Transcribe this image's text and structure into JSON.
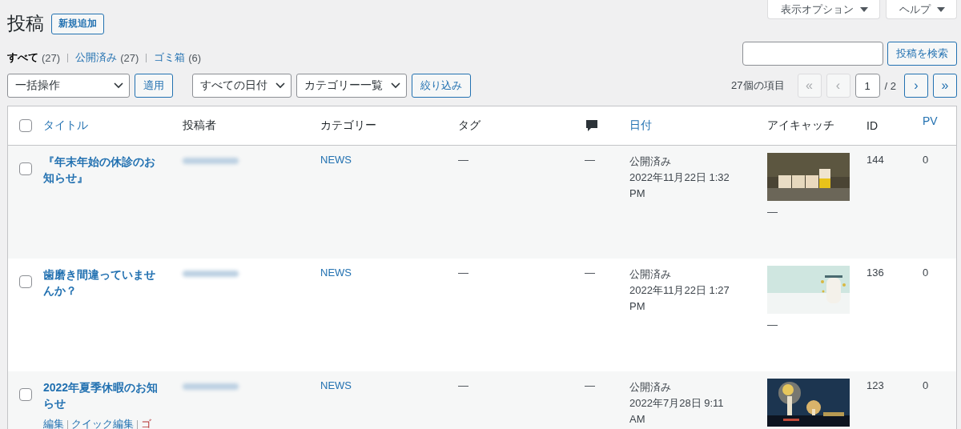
{
  "screen_tabs": [
    {
      "label": "表示オプション",
      "expanded": false
    },
    {
      "label": "ヘルプ",
      "expanded": false
    }
  ],
  "page_title": "投稿",
  "add_new_button": "新規追加",
  "views": [
    {
      "label": "すべて",
      "count": "(27)",
      "selected": true
    },
    {
      "label": "公開済み",
      "count": "(27)",
      "selected": false
    },
    {
      "label": "ゴミ箱",
      "count": "(6)",
      "selected": false
    }
  ],
  "search": {
    "button": "投稿を検索"
  },
  "bulk_actions": {
    "value": "一括操作",
    "button": "適用"
  },
  "filters": [
    {
      "value": "すべての日付"
    },
    {
      "value": "カテゴリー一覧"
    }
  ],
  "filter_button": "絞り込み",
  "pagination": {
    "items": "27個の項目",
    "current": "1",
    "total": "/ 2",
    "before": [
      {
        "label": "«",
        "disabled": true
      },
      {
        "label": "‹",
        "disabled": true
      }
    ],
    "after": [
      {
        "label": "›",
        "disabled": false
      },
      {
        "label": "»",
        "disabled": false
      }
    ]
  },
  "table": {
    "header_checked": false,
    "columns": [
      {
        "kind": "text",
        "label": "タイトル",
        "sortable": true
      },
      {
        "kind": "text",
        "label": "投稿者",
        "sortable": false
      },
      {
        "kind": "text",
        "label": "カテゴリー",
        "sortable": false
      },
      {
        "kind": "text",
        "label": "タグ",
        "sortable": false
      },
      {
        "kind": "comments"
      },
      {
        "kind": "text",
        "label": "日付",
        "sortable": true
      },
      {
        "kind": "text",
        "label": "アイキャッチ",
        "sortable": false
      },
      {
        "kind": "text",
        "label": "ID",
        "sortable": false
      },
      {
        "kind": "text",
        "label": "PV",
        "sortable": true
      }
    ],
    "rows": [
      {
        "checked": false,
        "title": "『年末年始の休診のお知らせ』",
        "category": "NEWS",
        "tags": "—",
        "comments": "—",
        "status": "公開済み",
        "date": "2022年11月22日 1:32 PM",
        "thumbnail_note": "—",
        "id": "144",
        "pv": "0"
      },
      {
        "checked": false,
        "title": "歯磨き間違っていませんか？",
        "category": "NEWS",
        "tags": "—",
        "comments": "—",
        "status": "公開済み",
        "date": "2022年11月22日 1:27 PM",
        "thumbnail_note": "—",
        "id": "136",
        "pv": "0"
      },
      {
        "checked": false,
        "title": "2022年夏季休暇のお知らせ",
        "category": "NEWS",
        "tags": "—",
        "comments": "—",
        "status": "公開済み",
        "date": "2022年7月28日 9:11 AM",
        "id": "123",
        "pv": "0",
        "actions": [
          {
            "label": "編集",
            "kind": "normal"
          },
          {
            "label": "クイック編集",
            "kind": "normal"
          },
          {
            "label": "ゴ",
            "kind": "danger"
          }
        ]
      }
    ]
  }
}
